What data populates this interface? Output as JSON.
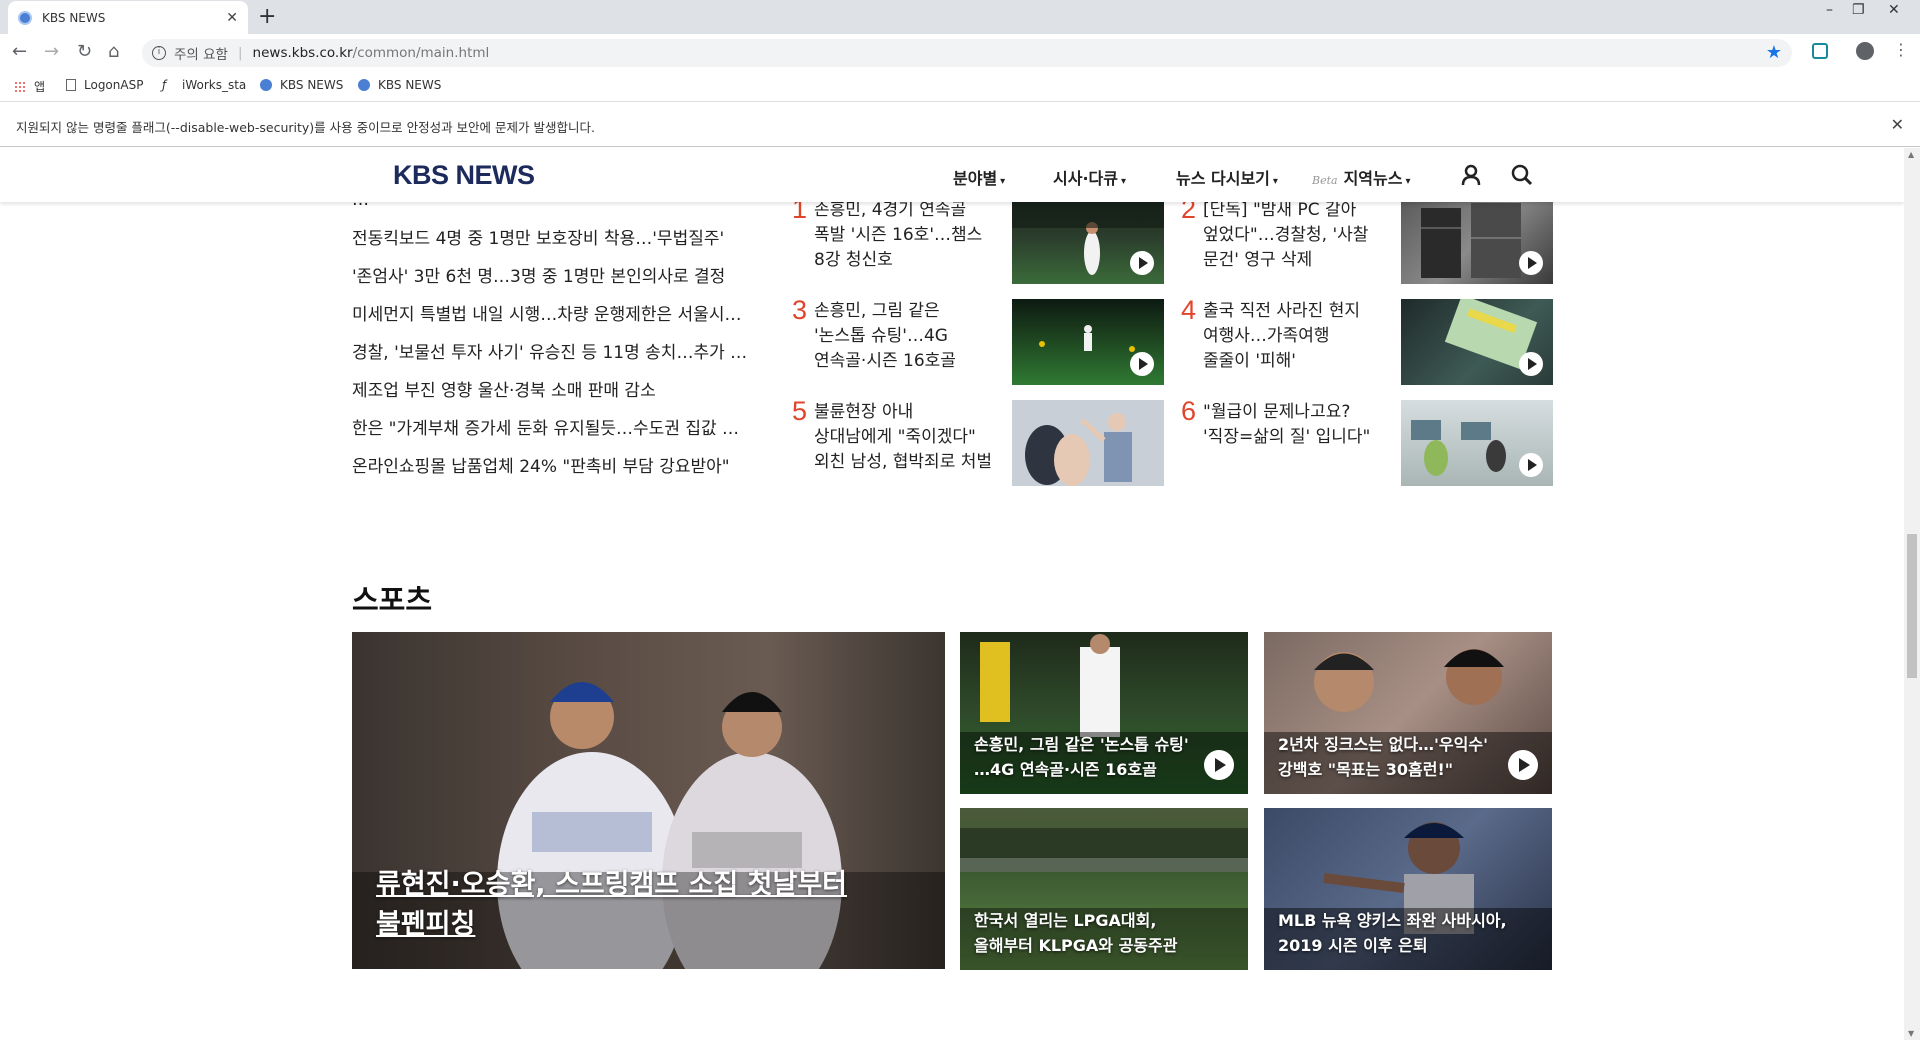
{
  "browser": {
    "tab_title": "KBS NEWS",
    "new_tab": "+",
    "omnibox_warning": "주의 요함",
    "url_host": "news.kbs.co.kr",
    "url_path": "/common/main.html",
    "bookmarks": [
      "앱",
      "LogonASP",
      "iWorks_sta",
      "KBS NEWS",
      "KBS NEWS"
    ],
    "infobar_message": "지원되지 않는 명령줄 플래그(--disable-web-security)를 사용 중이므로 안정성과 보안에 문제가 발생합니다."
  },
  "site": {
    "logo": "KBS NEWS",
    "nav": [
      "분야별",
      "시사·다큐",
      "뉴스 다시보기",
      "지역뉴스"
    ],
    "nav_beta": "Beta",
    "caret": "▾"
  },
  "headlines": [
    "전동킥보드 4명 중 1명만 보호장비 착용…'무법질주'",
    "'존엄사' 3만 6천 명…3명 중 1명만 본인의사로 결정",
    "미세먼지 특별법 내일 시행…차량 운행제한은 서울시…",
    "경찰, '보물선 투자 사기' 유승진 등 11명 송치…추가 …",
    "제조업 부진 영향 울산·경북 소매 판매 감소",
    "한은 \"가계부채 증가세 둔화 유지될듯…수도권 집값 …",
    "온라인쇼핑몰 납품업체 24% \"판촉비 부담 강요받아\""
  ],
  "ranked": [
    {
      "num": "1",
      "text": "손흥민, 4경기 연속골\n폭발 '시즌 16호'…챔스\n8강 청신호"
    },
    {
      "num": "2",
      "text": "[단독] \"밤새 PC 갈아\n엎었다\"…경찰청, '사찰\n문건' 영구 삭제"
    },
    {
      "num": "3",
      "text": "손흥민, 그림 같은\n'논스톱 슈팅'…4G\n연속골·시즌 16호골"
    },
    {
      "num": "4",
      "text": "출국 직전 사라진 현지\n여행사…가족여행\n줄줄이 '피해'"
    },
    {
      "num": "5",
      "text": "불륜현장 아내\n상대남에게 \"죽이겠다\"\n외친 남성, 협박죄로 처벌"
    },
    {
      "num": "6",
      "text": "\"월급이 문제나고요?\n'직장=삶의 질' 입니다\""
    }
  ],
  "sports": {
    "title": "스포츠",
    "main_title": "류현진·오승환, 스프링캠프 소집 첫날부터\n불펜피칭",
    "cards": [
      {
        "title": "손흥민, 그림 같은 '논스톱 슈팅'\n…4G 연속골·시즌 16호골",
        "has_play": true
      },
      {
        "title": "2년차 징크스는 없다…'우익수'\n강백호 \"목표는 30홈런!\"",
        "has_play": true
      },
      {
        "title": "한국서 열리는 LPGA대회,\n올해부터 KLPGA와 공동주관",
        "has_play": false
      },
      {
        "title": "MLB 뉴욕 양키스 좌완 사바시아,\n2019 시즌 이후 은퇴",
        "has_play": false
      }
    ]
  },
  "colors": {
    "brand": "#1c2a5c",
    "rank": "#e0452c",
    "star": "#1a73e8"
  }
}
